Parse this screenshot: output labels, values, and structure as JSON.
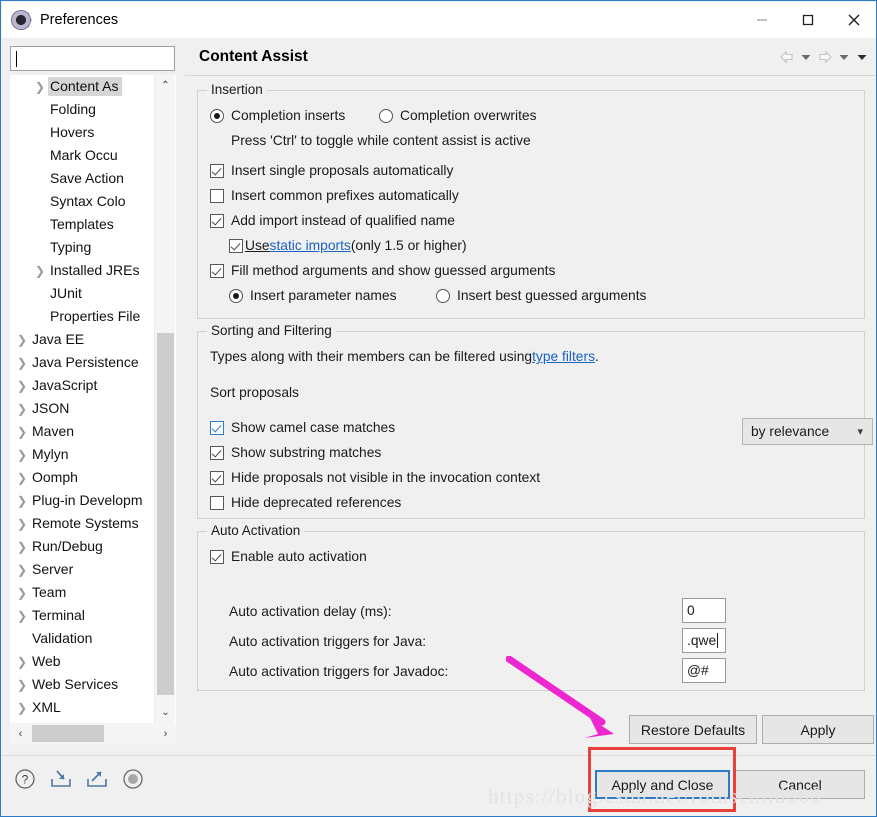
{
  "window": {
    "title": "Preferences",
    "icon": "gear-icon",
    "minimize_label": "—",
    "maximize_label": "□",
    "close_label": "✕"
  },
  "sidebar": {
    "filter": {
      "value": "",
      "placeholder": ""
    },
    "items": [
      {
        "label": "Content As",
        "depth": 1,
        "arrow": true,
        "selected": true
      },
      {
        "label": "Folding",
        "depth": 1,
        "arrow": false,
        "selected": false
      },
      {
        "label": "Hovers",
        "depth": 1,
        "arrow": false,
        "selected": false
      },
      {
        "label": "Mark Occu",
        "depth": 1,
        "arrow": false,
        "selected": false
      },
      {
        "label": "Save Action",
        "depth": 1,
        "arrow": false,
        "selected": false
      },
      {
        "label": "Syntax Colo",
        "depth": 1,
        "arrow": false,
        "selected": false
      },
      {
        "label": "Templates",
        "depth": 1,
        "arrow": false,
        "selected": false
      },
      {
        "label": "Typing",
        "depth": 1,
        "arrow": false,
        "selected": false
      },
      {
        "label": "Installed JREs",
        "depth": 1,
        "arrow": true,
        "selected": false
      },
      {
        "label": "JUnit",
        "depth": 1,
        "arrow": false,
        "selected": false
      },
      {
        "label": "Properties File",
        "depth": 1,
        "arrow": false,
        "selected": false
      },
      {
        "label": "Java EE",
        "depth": 0,
        "arrow": true,
        "selected": false
      },
      {
        "label": "Java Persistence",
        "depth": 0,
        "arrow": true,
        "selected": false
      },
      {
        "label": "JavaScript",
        "depth": 0,
        "arrow": true,
        "selected": false
      },
      {
        "label": "JSON",
        "depth": 0,
        "arrow": true,
        "selected": false
      },
      {
        "label": "Maven",
        "depth": 0,
        "arrow": true,
        "selected": false
      },
      {
        "label": "Mylyn",
        "depth": 0,
        "arrow": true,
        "selected": false
      },
      {
        "label": "Oomph",
        "depth": 0,
        "arrow": true,
        "selected": false
      },
      {
        "label": "Plug-in Developm",
        "depth": 0,
        "arrow": true,
        "selected": false
      },
      {
        "label": "Remote Systems",
        "depth": 0,
        "arrow": true,
        "selected": false
      },
      {
        "label": "Run/Debug",
        "depth": 0,
        "arrow": true,
        "selected": false
      },
      {
        "label": "Server",
        "depth": 0,
        "arrow": true,
        "selected": false
      },
      {
        "label": "Team",
        "depth": 0,
        "arrow": true,
        "selected": false
      },
      {
        "label": "Terminal",
        "depth": 0,
        "arrow": true,
        "selected": false
      },
      {
        "label": "Validation",
        "depth": 0,
        "arrow": false,
        "selected": false
      },
      {
        "label": "Web",
        "depth": 0,
        "arrow": true,
        "selected": false
      },
      {
        "label": "Web Services",
        "depth": 0,
        "arrow": true,
        "selected": false
      },
      {
        "label": "XML",
        "depth": 0,
        "arrow": true,
        "selected": false
      }
    ],
    "scroll_up": "⌃",
    "scroll_down": "⌄",
    "scroll_left": "‹",
    "scroll_right": "›"
  },
  "page": {
    "title": "Content Assist",
    "nav_back": "back-arrow-icon",
    "nav_forward": "forward-arrow-icon"
  },
  "insertion": {
    "group_title": "Insertion",
    "radio_inserts": "Completion inserts",
    "radio_overwrites": "Completion overwrites",
    "hint": "Press 'Ctrl' to toggle while content assist is active",
    "cb_single": "Insert single proposals automatically",
    "cb_prefixes": "Insert common prefixes automatically",
    "cb_addimport": "Add import instead of qualified name",
    "cb_static_pre": "Use ",
    "cb_static_link": "static imports",
    "cb_static_post": " (only 1.5 or higher)",
    "cb_fill": "Fill method arguments and show guessed arguments",
    "radio_paramnames": "Insert parameter names",
    "radio_bestguess": "Insert best guessed arguments"
  },
  "sorting": {
    "group_title": "Sorting and Filtering",
    "desc_pre": "Types along with their members can be filtered using ",
    "desc_link": "type filters",
    "desc_post": ".",
    "sort_label": "Sort proposals",
    "sort_value": "by relevance",
    "cb_camel": "Show camel case matches",
    "cb_substring": "Show substring matches",
    "cb_hide_invisible": "Hide proposals not visible in the invocation context",
    "cb_hide_deprecated": "Hide deprecated references"
  },
  "auto_activation": {
    "group_title": "Auto Activation",
    "cb_enable": "Enable auto activation",
    "label_delay": "Auto activation delay (ms):",
    "value_delay": "0",
    "label_java": "Auto activation triggers for Java:",
    "value_java": ".qwe",
    "label_javadoc": "Auto activation triggers for Javadoc:",
    "value_javadoc": "@#"
  },
  "buttons": {
    "restore_defaults": "Restore Defaults",
    "apply": "Apply",
    "apply_and_close": "Apply and Close",
    "cancel": "Cancel"
  },
  "footer_icons": [
    {
      "name": "help-icon",
      "glyph": "?"
    },
    {
      "name": "import-icon",
      "glyph": "↙"
    },
    {
      "name": "export-icon",
      "glyph": "↗"
    },
    {
      "name": "record-icon",
      "glyph": "●"
    }
  ],
  "annotations": {
    "watermark": "https://blog.csdn.net/rothschild666",
    "arrow_color": "#ec27d0",
    "rect_color": "#e8403a",
    "focus_color": "#2f7ac4"
  }
}
